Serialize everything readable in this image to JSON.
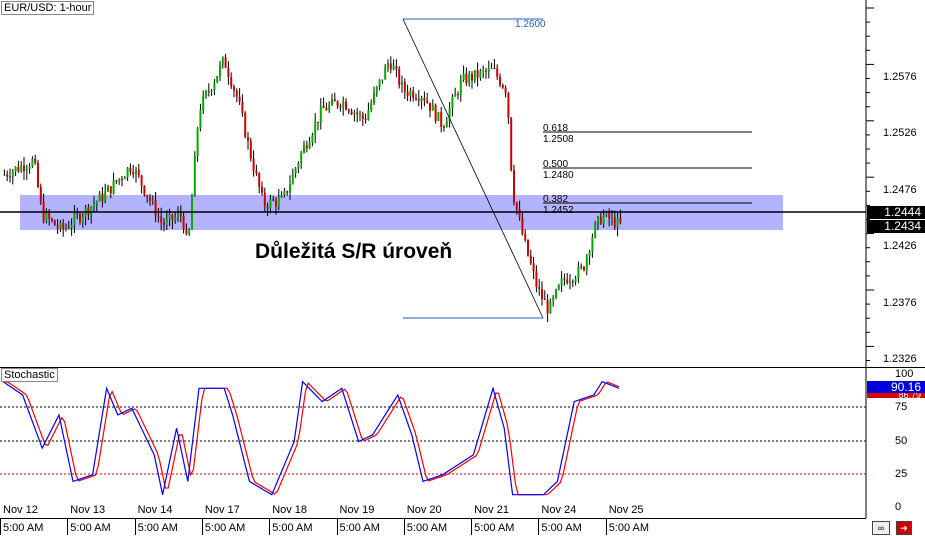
{
  "header": {
    "title": "EUR/USD: 1-hour",
    "stoch_title": "Stochastic"
  },
  "annotation": "Důležitá S/R úroveň",
  "price_axis": {
    "ticks": [
      "1.2576",
      "1.2526",
      "1.2476",
      "1.2426",
      "1.2376",
      "1.2326"
    ],
    "current_bid": "1.2444",
    "current_other": "1.2434"
  },
  "stoch_axis": {
    "ticks": [
      "100",
      "75",
      "50",
      "25",
      "0"
    ],
    "k_value": "90.16",
    "d_value": "86.79"
  },
  "fib": {
    "high": "1.2600",
    "levels": [
      {
        "ratio": "0.618",
        "price": "1.2508"
      },
      {
        "ratio": "0.500",
        "price": "1.2480"
      },
      {
        "ratio": "0.382",
        "price": "1.2452"
      }
    ]
  },
  "x_axis": [
    {
      "d": "Nov 12",
      "t": "5:00 AM"
    },
    {
      "d": "Nov 13",
      "t": "5:00 AM"
    },
    {
      "d": "Nov 14",
      "t": "5:00 AM"
    },
    {
      "d": "Nov 17",
      "t": "5:00 AM"
    },
    {
      "d": "Nov 18",
      "t": "5:00 AM"
    },
    {
      "d": "Nov 19",
      "t": "5:00 AM"
    },
    {
      "d": "Nov 20",
      "t": "5:00 AM"
    },
    {
      "d": "Nov 21",
      "t": "5:00 AM"
    },
    {
      "d": "Nov 24",
      "t": "5:00 AM"
    },
    {
      "d": "Nov 25",
      "t": "5:00 AM"
    }
  ],
  "colors": {
    "up": "#00aa00",
    "down": "#cc0000",
    "band": "#9999ff",
    "k": "#0000ff",
    "d": "#ff0000"
  },
  "chart_data": {
    "type": "candlestick",
    "symbol": "EUR/USD",
    "timeframe": "1-hour",
    "price_path": [
      [
        0,
        1.249
      ],
      [
        11,
        1.2503
      ],
      [
        14,
        1.2455
      ],
      [
        21,
        1.2441
      ],
      [
        36,
        1.2472
      ],
      [
        46,
        1.2499
      ],
      [
        57,
        1.2446
      ],
      [
        64,
        1.2455
      ],
      [
        66,
        1.2424
      ],
      [
        70,
        1.2548
      ],
      [
        79,
        1.2592
      ],
      [
        84,
        1.2556
      ],
      [
        88,
        1.2512
      ],
      [
        93,
        1.2464
      ],
      [
        100,
        1.2468
      ],
      [
        107,
        1.2512
      ],
      [
        114,
        1.2548
      ],
      [
        121,
        1.2556
      ],
      [
        129,
        1.2539
      ],
      [
        138,
        1.2592
      ],
      [
        143,
        1.2565
      ],
      [
        150,
        1.2561
      ],
      [
        157,
        1.2534
      ],
      [
        164,
        1.2574
      ],
      [
        175,
        1.2583
      ],
      [
        180,
        1.2565
      ],
      [
        182,
        1.2476
      ],
      [
        186,
        1.2432
      ],
      [
        191,
        1.2388
      ],
      [
        195,
        1.237
      ],
      [
        200,
        1.2397
      ],
      [
        207,
        1.2406
      ],
      [
        211,
        1.2441
      ],
      [
        214,
        1.2454
      ],
      [
        221,
        1.2445
      ]
    ],
    "stochastic": [
      [
        0,
        95
      ],
      [
        7,
        85
      ],
      [
        14,
        45
      ],
      [
        20,
        70
      ],
      [
        25,
        20
      ],
      [
        32,
        25
      ],
      [
        37,
        90
      ],
      [
        41,
        70
      ],
      [
        46,
        75
      ],
      [
        54,
        40
      ],
      [
        57,
        10
      ],
      [
        62,
        60
      ],
      [
        66,
        20
      ],
      [
        70,
        90
      ],
      [
        79,
        90
      ],
      [
        82,
        70
      ],
      [
        88,
        20
      ],
      [
        96,
        10
      ],
      [
        104,
        50
      ],
      [
        107,
        95
      ],
      [
        114,
        80
      ],
      [
        121,
        90
      ],
      [
        127,
        50
      ],
      [
        132,
        55
      ],
      [
        141,
        85
      ],
      [
        146,
        55
      ],
      [
        150,
        20
      ],
      [
        157,
        25
      ],
      [
        168,
        40
      ],
      [
        175,
        90
      ],
      [
        179,
        60
      ],
      [
        182,
        10
      ],
      [
        193,
        10
      ],
      [
        198,
        20
      ],
      [
        204,
        80
      ],
      [
        211,
        85
      ],
      [
        214,
        95
      ],
      [
        220,
        90
      ]
    ],
    "ylim": [
      1.2316,
      1.2626
    ]
  }
}
